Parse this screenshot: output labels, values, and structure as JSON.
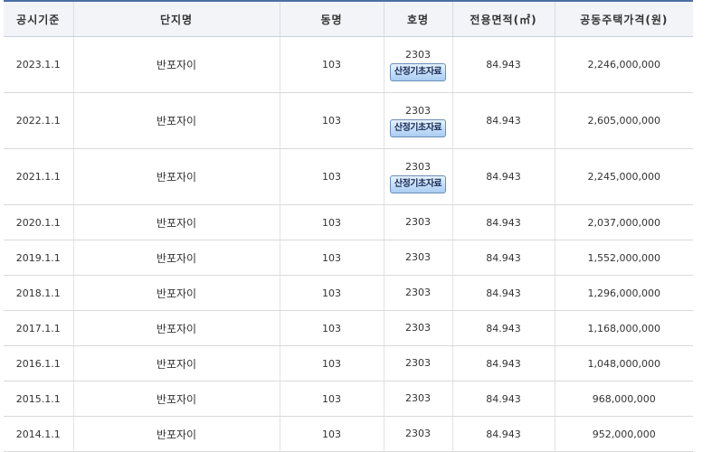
{
  "headers": {
    "date": "공시기준",
    "complex": "단지명",
    "building": "동명",
    "unit": "호명",
    "area": "전용면적(㎡)",
    "price": "공동주택가격(원)"
  },
  "button_label": "산정기초자료",
  "rows": [
    {
      "date": "2023.1.1",
      "complex": "반포자이",
      "building": "103",
      "unit": "2303",
      "area": "84.943",
      "price": "2,246,000,000",
      "has_button": true
    },
    {
      "date": "2022.1.1",
      "complex": "반포자이",
      "building": "103",
      "unit": "2303",
      "area": "84.943",
      "price": "2,605,000,000",
      "has_button": true
    },
    {
      "date": "2021.1.1",
      "complex": "반포자이",
      "building": "103",
      "unit": "2303",
      "area": "84.943",
      "price": "2,245,000,000",
      "has_button": true
    },
    {
      "date": "2020.1.1",
      "complex": "반포자이",
      "building": "103",
      "unit": "2303",
      "area": "84.943",
      "price": "2,037,000,000",
      "has_button": false
    },
    {
      "date": "2019.1.1",
      "complex": "반포자이",
      "building": "103",
      "unit": "2303",
      "area": "84.943",
      "price": "1,552,000,000",
      "has_button": false
    },
    {
      "date": "2018.1.1",
      "complex": "반포자이",
      "building": "103",
      "unit": "2303",
      "area": "84.943",
      "price": "1,296,000,000",
      "has_button": false
    },
    {
      "date": "2017.1.1",
      "complex": "반포자이",
      "building": "103",
      "unit": "2303",
      "area": "84.943",
      "price": "1,168,000,000",
      "has_button": false
    },
    {
      "date": "2016.1.1",
      "complex": "반포자이",
      "building": "103",
      "unit": "2303",
      "area": "84.943",
      "price": "1,048,000,000",
      "has_button": false
    },
    {
      "date": "2015.1.1",
      "complex": "반포자이",
      "building": "103",
      "unit": "2303",
      "area": "84.943",
      "price": "968,000,000",
      "has_button": false
    },
    {
      "date": "2014.1.1",
      "complex": "반포자이",
      "building": "103",
      "unit": "2303",
      "area": "84.943",
      "price": "952,000,000",
      "has_button": false
    }
  ]
}
